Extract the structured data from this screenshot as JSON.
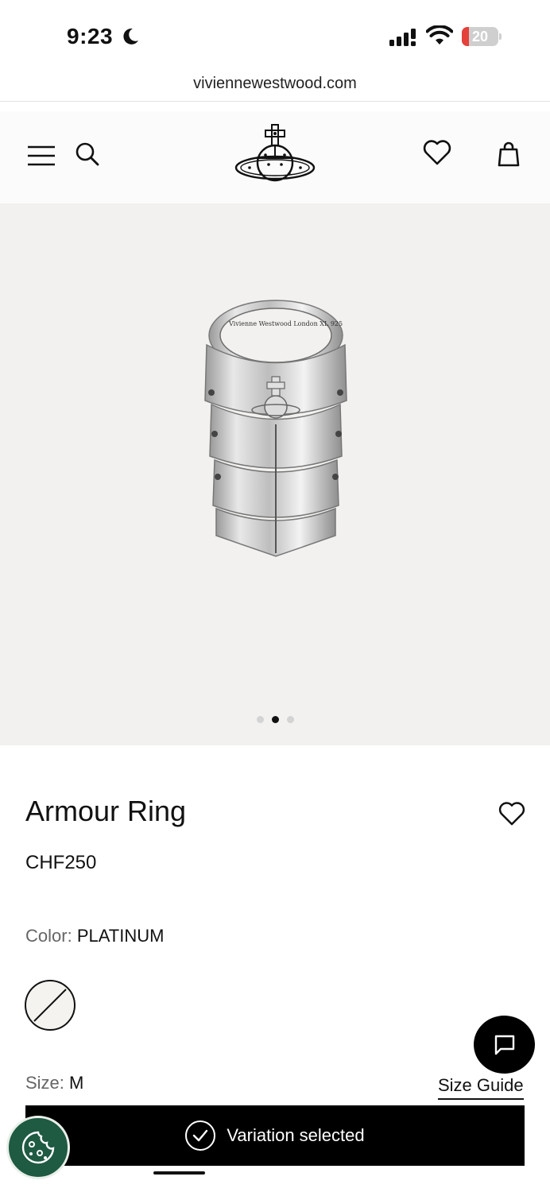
{
  "status_bar": {
    "time": "9:23",
    "battery_percent": "20",
    "battery_level": 0.2,
    "battery_color": "#e5403a"
  },
  "browser": {
    "url": "viviennewestwood.com"
  },
  "header": {
    "menu_icon": "hamburger-menu-icon",
    "search_icon": "search-icon",
    "logo_icon": "orb-logo-icon",
    "wishlist_icon": "heart-icon",
    "bag_icon": "shopping-bag-icon"
  },
  "gallery": {
    "image_name": "armour-ring-image",
    "image_inscription": "Vivienne Westwood London XL 925",
    "slide_count": 3,
    "active_slide": 2
  },
  "product": {
    "title": "Armour Ring",
    "price": "CHF250",
    "color_label": "Color:",
    "color_value": "PLATINUM",
    "size_label": "Size:",
    "size_value": "M",
    "size_guide": "Size Guide"
  },
  "actions": {
    "variation_text": "Variation selected",
    "chat_icon": "chat-bubble-icon",
    "cookie_icon": "cookie-icon"
  },
  "colors": {
    "accent": "#000000",
    "cookie_bg": "#1f5a43",
    "gallery_bg": "#f2f1ef"
  }
}
